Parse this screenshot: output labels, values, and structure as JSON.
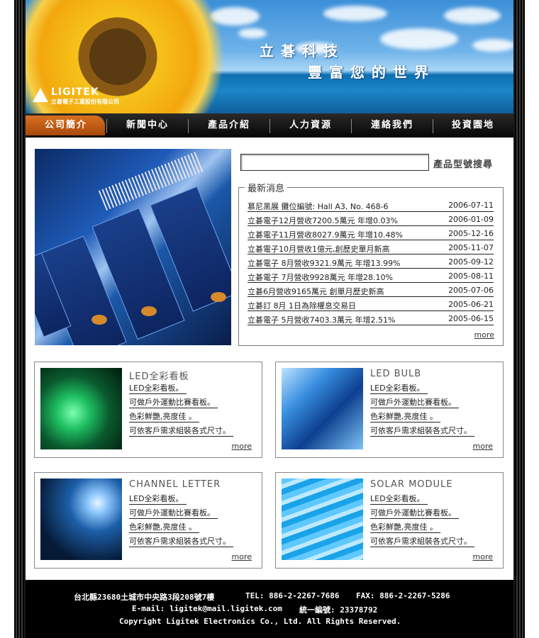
{
  "banner": {
    "slogan_line1": "立碁科技",
    "slogan_line2": "豐富您的世界",
    "logo_name": "LIGITEK",
    "logo_sub": "立碁電子工業股份有限公司"
  },
  "nav": {
    "items": [
      {
        "label": "公司簡介"
      },
      {
        "label": "新聞中心"
      },
      {
        "label": "產品介紹"
      },
      {
        "label": "人力資源"
      },
      {
        "label": "連絡我們"
      },
      {
        "label": "投資園地"
      }
    ]
  },
  "search": {
    "value": "",
    "button_label": "產品型號搜尋"
  },
  "news": {
    "heading": "最新消息",
    "items": [
      {
        "title": "慕尼黑展 攤位編號: Hall A3, No. 468-6",
        "date": "2006-07-11"
      },
      {
        "title": "立碁電子12月營收7200.5萬元 年增0.03%",
        "date": "2006-01-09"
      },
      {
        "title": "立碁電子11月營收8027.9萬元 年增10.48%",
        "date": "2005-12-16"
      },
      {
        "title": "立碁電子10月營收1億元,創歷史單月新高",
        "date": "2005-11-07"
      },
      {
        "title": "立碁電子 8月營收9321.9萬元 年增13.99%",
        "date": "2005-09-12"
      },
      {
        "title": "立碁電子 7月營收9928萬元 年增28.10%",
        "date": "2005-08-11"
      },
      {
        "title": "立碁6月營收9165萬元 創單月歷史新高",
        "date": "2005-07-06"
      },
      {
        "title": "立碁訂 8月 1日為除權息交易日",
        "date": "2005-06-21"
      },
      {
        "title": "立碁電子 5月營收7403.3萬元 年增2.51%",
        "date": "2005-06-15"
      }
    ],
    "more_label": "more"
  },
  "products": [
    {
      "title": "LED全彩看板",
      "lines": [
        "LED全彩看板。",
        "可做戶外運動比賽看板。",
        "色彩鮮艷,亮度佳 。",
        "可依客戶需求組裝各式尺寸。"
      ],
      "more_label": "more"
    },
    {
      "title": "LED BULB",
      "lines": [
        "LED全彩看板。",
        "可做戶外運動比賽看板。",
        "色彩鮮艷,亮度佳 。",
        "可依客戶需求組裝各式尺寸。"
      ],
      "more_label": "more"
    },
    {
      "title": "CHANNEL LETTER",
      "lines": [
        "LED全彩看板。",
        "可做戶外運動比賽看板。",
        "色彩鮮艷,亮度佳 。",
        "可依客戶需求組裝各式尺寸。"
      ],
      "more_label": "more"
    },
    {
      "title": "SOLAR MODULE",
      "lines": [
        "LED全彩看板。",
        "可做戶外運動比賽看板。",
        "色彩鮮艷,亮度佳 。",
        "可依客戶需求組裝各式尺寸。"
      ],
      "more_label": "more"
    }
  ],
  "footer": {
    "address": "台北縣23680土城市中央路3段208號7樓",
    "tel": "TEL: 886-2-2267-7686",
    "fax": "FAX: 886-2-2267-5286",
    "email": "E-mail: ligitek@mail.ligitek.com",
    "tax_id": "統一編號: 23378792",
    "copyright": "Copyright  Ligitek Electronics Co., Ltd. All Rights Reserved."
  },
  "colors": {
    "nav_active": "#c45f15",
    "nav_bg": "#111111",
    "frame": "#1a1a1a"
  }
}
